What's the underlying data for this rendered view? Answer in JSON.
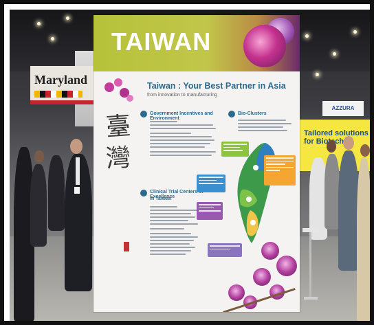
{
  "banner": {
    "title": "TAIWAN",
    "subtitle": "Taiwan : Your Best Partner in Asia",
    "tagline": "from innovation to manufacturing",
    "calligraphy": [
      "臺",
      "灣"
    ],
    "sections": {
      "gov": "Government Incentives and Environment",
      "bio": "Bio-Clusters",
      "clinical": "Clinical Trial Centers of Excellence",
      "clinical_sub": "in Taiwan"
    }
  },
  "background": {
    "booth_left_label": "Maryland",
    "booth_right_label": "Tailored solutions for Biotech",
    "booth_right_logo": "AZZURA"
  },
  "colors": {
    "banner_top_green": "#b6c23a",
    "orchid_purple": "#b23f9e",
    "heading_blue": "#2a6a8e",
    "map_green": "#3c9a4a",
    "map_blue": "#2f7fc1"
  },
  "icons": [
    "orchid-flower-icon",
    "taiwan-map-icon",
    "callout-box-icon"
  ]
}
